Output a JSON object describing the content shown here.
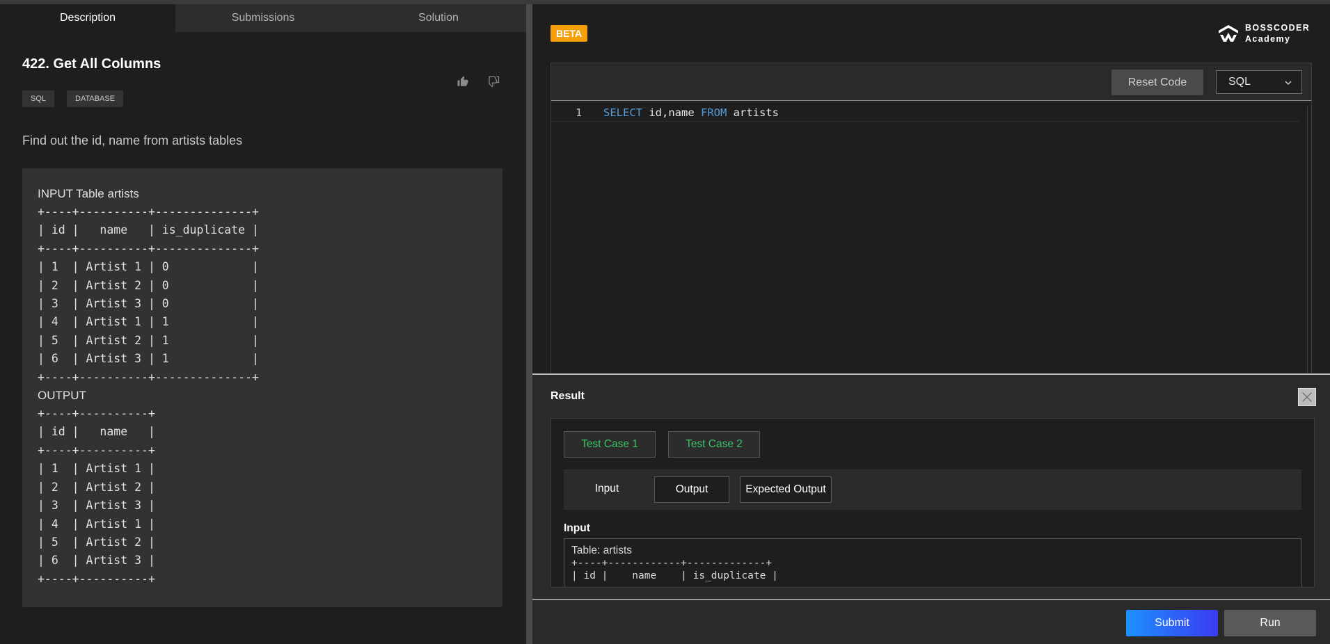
{
  "tabs": [
    "Description",
    "Submissions",
    "Solution"
  ],
  "problem": {
    "title": "422. Get All Columns",
    "tags": [
      "SQL",
      "DATABASE"
    ],
    "description": "Find out the id, name from artists tables",
    "input_heading": "INPUT Table artists",
    "input_table": "+----+----------+--------------+\n| id |   name   | is_duplicate |\n+----+----------+--------------+\n| 1  | Artist 1 | 0            |\n| 2  | Artist 2 | 0            |\n| 3  | Artist 3 | 0            |\n| 4  | Artist 1 | 1            |\n| 5  | Artist 2 | 1            |\n| 6  | Artist 3 | 1            |\n+----+----------+--------------+",
    "output_heading": "OUTPUT",
    "output_table": "+----+----------+\n| id |   name   |\n+----+----------+\n| 1  | Artist 1 |\n| 2  | Artist 2 |\n| 3  | Artist 3 |\n| 4  | Artist 1 |\n| 5  | Artist 2 |\n| 6  | Artist 3 |\n+----+----------+"
  },
  "header": {
    "beta_label": "BETA",
    "logo_line1": "BOSSCODER",
    "logo_line2": "Academy"
  },
  "editor": {
    "reset_label": "Reset Code",
    "language": "SQL",
    "line_number": "1",
    "code_kw1": "SELECT",
    "code_mid": " id,name ",
    "code_kw2": "FROM",
    "code_tail": " artists"
  },
  "result": {
    "title": "Result",
    "test_cases": [
      "Test Case 1",
      "Test Case 2"
    ],
    "io_tabs": [
      "Input",
      "Output",
      "Expected Output"
    ],
    "input_label": "Input",
    "input_caption": "Table: artists",
    "input_preview": "+----+------------+-------------+\n| id |    name    | is_duplicate |"
  },
  "footer": {
    "submit_label": "Submit",
    "run_label": "Run"
  },
  "colors": {
    "accent_beta": "#f59f0b",
    "test_case_green": "#3cc36a",
    "sql_keyword": "#569cd6",
    "submit_gradient_start": "#1e90ff",
    "submit_gradient_end": "#3b3bf0"
  }
}
